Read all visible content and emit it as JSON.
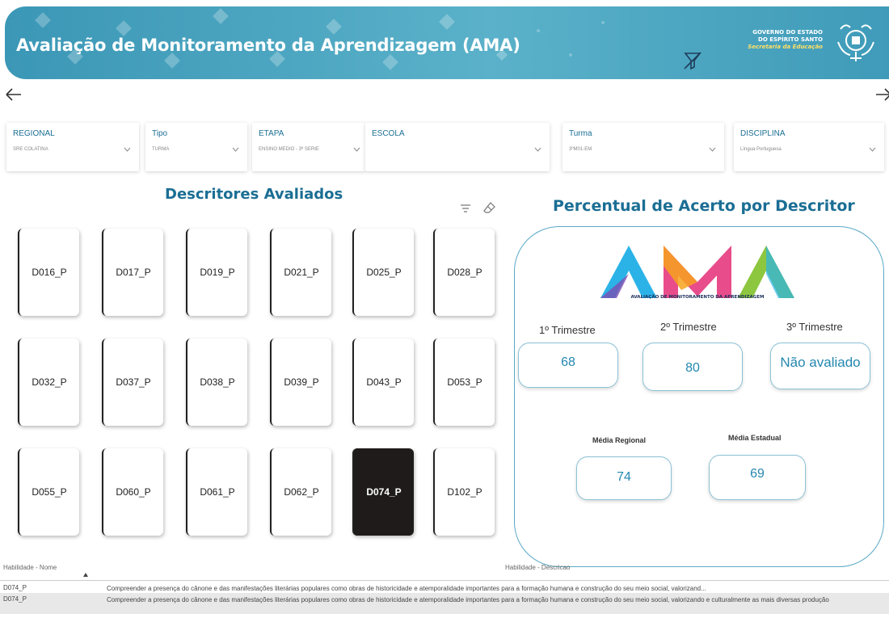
{
  "header": {
    "title": "Avaliação de Monitoramento da Aprendizagem (AMA)",
    "gov_line1": "GOVERNO DO ESTADO",
    "gov_line2": "DO ESPÍRITO SANTO",
    "gov_line3": "Secretaria da Educação"
  },
  "filters": [
    {
      "label": "REGIONAL",
      "value": "SRE COLATINA"
    },
    {
      "label": "Tipo",
      "value": "TURMA"
    },
    {
      "label": "ETAPA",
      "value": "ENSINO MEDIO - 3ª SERIE"
    },
    {
      "label": "ESCOLA",
      "value": ""
    },
    {
      "label": "Turma",
      "value": "3ºM01-EM"
    },
    {
      "label": "DISCIPLINA",
      "value": "Língua Portuguesa"
    }
  ],
  "descritores": {
    "title": "Descritores Avaliados",
    "selected": "D074_P",
    "items": [
      "D016_P",
      "D017_P",
      "D019_P",
      "D021_P",
      "D025_P",
      "D028_P",
      "D032_P",
      "D037_P",
      "D038_P",
      "D039_P",
      "D043_P",
      "D053_P",
      "D055_P",
      "D060_P",
      "D061_P",
      "D062_P",
      "D074_P",
      "D102_P"
    ]
  },
  "percentual": {
    "title": "Percentual de Acerto por Descritor",
    "logo_text": "AMA",
    "logo_sub": "AVALIAÇÃO DE MONITORAMENTO DA APRENDIZAGEM",
    "t1_label": "1º Trimestre",
    "t2_label": "2º Trimestre",
    "t3_label": "3º Trimestre",
    "t1_value": "68",
    "t2_value": "80",
    "t3_value": "Não avaliado",
    "media_regional_label": "Média Regional",
    "media_estadual_label": "Média Estadual",
    "media_regional_value": "74",
    "media_estadual_value": "69"
  },
  "table": {
    "col_name": "Habilidade - Nome",
    "col_desc": "Habilidade - Descricao",
    "rows": [
      {
        "name": "D074_P",
        "desc": "Compreender a presença do cânone e das manifestações literárias populares como obras de historicidade e atemporalidade importantes para a formação humana e construção do seu meio social, valorizand..."
      },
      {
        "name": "D074_P",
        "desc": "Compreender a presença do cânone e das manifestações literárias populares como obras de historicidade e atemporalidade importantes para a formação humana e construção do seu meio social, valorizando e culturalmente as mais diversas produção"
      }
    ]
  },
  "colors": {
    "header": "#3b97b6",
    "accent": "#1b6e94",
    "value_text": "#2487b0",
    "selected_card": "#1f1b1b"
  },
  "icons": {
    "clear_filters": "clear-filters-icon",
    "back": "arrow-left-icon",
    "forward": "arrow-right-icon",
    "filter": "filter-icon",
    "eraser": "eraser-icon"
  }
}
